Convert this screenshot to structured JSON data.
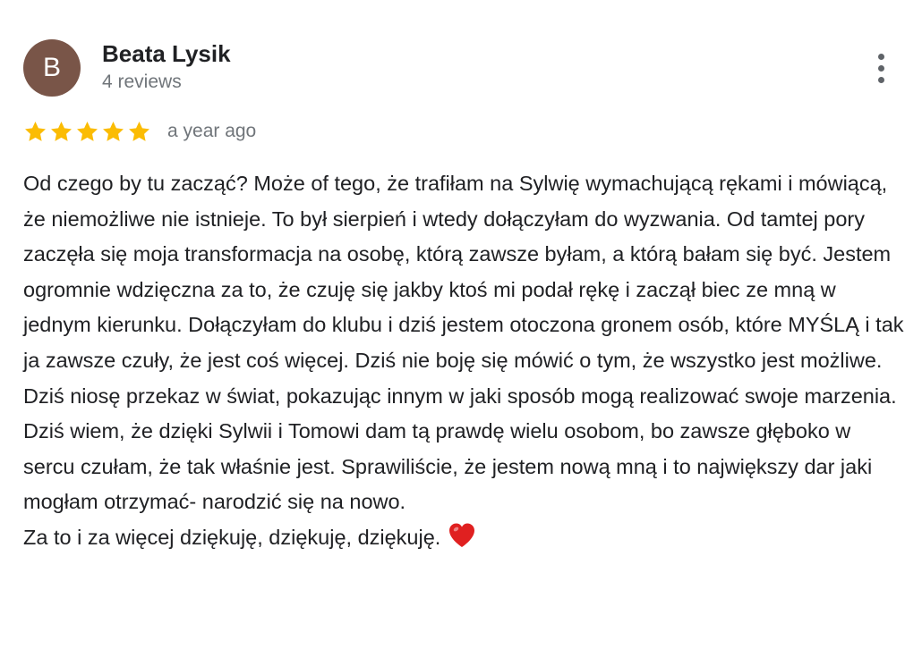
{
  "review": {
    "avatar_letter": "B",
    "author_name": "Beata Lysik",
    "review_count": "4 reviews",
    "rating": 5,
    "rating_max": 5,
    "date": "a year ago",
    "body": "Od czego by tu zacząć? Może of tego, że trafiłam na Sylwię wymachującą rękami i mówiącą, że niemożliwe nie istnieje. To był sierpień i wtedy dołączyłam do wyzwania. Od tamtej pory zaczęła się moja transformacja na osobę, którą zawsze byłam, a którą bałam się być. Jestem ogromnie wdzięczna za to, że czuję się jakby ktoś mi podał rękę i zaczął biec ze mną w jednym kierunku. Dołączyłam do klubu i dziś jestem otoczona gronem osób, które MYŚLĄ i tak ja zawsze czuły, że jest coś więcej. Dziś nie boję się mówić o tym, że wszystko jest możliwe. Dziś niosę przekaz w świat, pokazując innym w jaki sposób mogą realizować swoje marzenia. Dziś wiem, że dzięki Sylwii i Tomowi dam tą prawdę wielu osobom, bo zawsze głęboko w sercu czułam, że tak właśnie jest. Sprawiliście, że jestem nową mną i to największy dar jaki mogłam otrzymać- narodzić się na nowo.",
    "closing_line": "Za to i za więcej dziękuję, dziękuję, dziękuję."
  },
  "icons": {
    "menu": "more-vert-icon",
    "star": "star-icon",
    "heart": "heart-icon"
  },
  "colors": {
    "avatar_bg": "#795548",
    "star": "#FBBC04",
    "heart": "#E02020",
    "secondary_text": "#70757a"
  }
}
